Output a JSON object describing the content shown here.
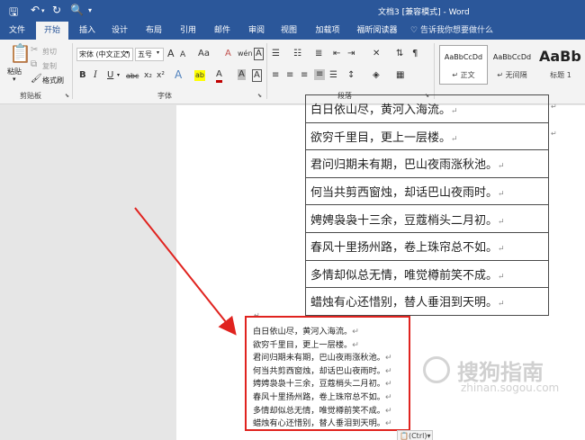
{
  "titlebar": {
    "title": "文档3 [兼容模式] - Word",
    "save_icon": "save-icon",
    "undo_icon": "undo-icon",
    "redo_icon": "redo-icon",
    "print_preview_icon": "print-preview-icon"
  },
  "tabs": [
    "文件",
    "开始",
    "插入",
    "设计",
    "布局",
    "引用",
    "邮件",
    "审阅",
    "视图",
    "加载项",
    "福昕阅读器"
  ],
  "active_tab": "开始",
  "tell_me": "告诉我你想要做什么",
  "clipboard": {
    "paste": "粘贴",
    "cut": "剪切",
    "copy": "复制",
    "format_painter": "格式刷",
    "group_label": "剪贴板"
  },
  "font": {
    "font_name": "宋体 (中文正文)",
    "font_size": "五号",
    "grow": "A",
    "shrink": "A",
    "case": "Aa",
    "clear": "A",
    "phonetic": "wén",
    "border": "A",
    "bold": "B",
    "italic": "I",
    "underline": "U",
    "strike": "abc",
    "subscript": "x₂",
    "superscript": "x²",
    "text_effect": "A",
    "highlight": "ab",
    "font_color": "A",
    "shading": "A",
    "char_border": "A",
    "group_label": "字体"
  },
  "paragraph": {
    "group_label": "段落"
  },
  "styles": [
    {
      "sample": "AaBbCcDd",
      "name": "正文",
      "selected": true
    },
    {
      "sample": "AaBbCcDd",
      "name": "无间隔",
      "selected": false
    },
    {
      "sample": "AaBb",
      "name": "标题 1",
      "selected": false
    }
  ],
  "table_rows": [
    "白日依山尽，黄河入海流。",
    "欲穷千里目，更上一层楼。",
    "君问归期未有期，巴山夜雨涨秋池。",
    "何当共剪西窗烛，却话巴山夜雨时。",
    "娉娉袅袅十三余，豆蔻梢头二月初。",
    "春风十里扬州路，卷上珠帘总不如。",
    "多情却似总无情，唯觉樽前笑不成。",
    "蜡烛有心还惜别，替人垂泪到天明。"
  ],
  "pasted_lines": [
    "白日依山尽，黄河入海流。",
    "欲穷千里目，更上一层楼。",
    "君问归期未有期，巴山夜雨涨秋池。",
    "何当共剪西窗烛，却话巴山夜雨时。",
    "娉娉袅袅十三余，豆蔻梢头二月初。",
    "春风十里扬州路，卷上珠帘总不如。",
    "多情却似总无情，唯觉樽前笑不成。",
    "蜡烛有心还惜别，替人垂泪到天明。"
  ],
  "paste_options": "(Ctrl)",
  "para_mark": "↵",
  "watermark": {
    "text": "搜狗指南",
    "url": "zhinan.sogou.com"
  },
  "colors": {
    "word_blue": "#2b579a",
    "highlight_red": "#e0231f"
  }
}
